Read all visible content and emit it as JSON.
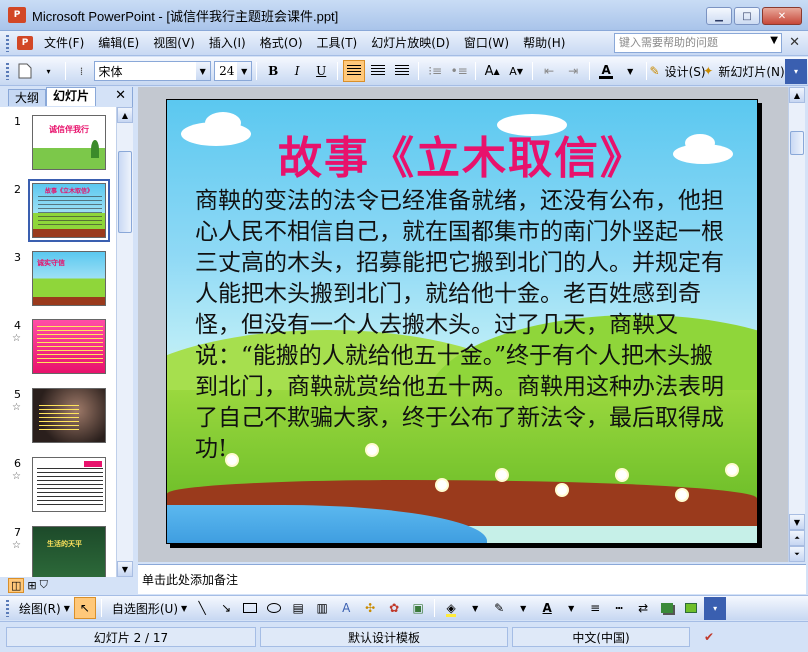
{
  "window": {
    "title": "Microsoft PowerPoint - [诚信伴我行主题班会课件.ppt]",
    "app_icon_label": "P"
  },
  "window_buttons": {
    "minimize": "▁",
    "maximize": "□",
    "close": "✕"
  },
  "menu": {
    "items": [
      "文件(F)",
      "编辑(E)",
      "视图(V)",
      "插入(I)",
      "格式(O)",
      "工具(T)",
      "幻灯片放映(D)",
      "窗口(W)",
      "帮助(H)"
    ],
    "help_placeholder": "键入需要帮助的问题"
  },
  "toolbar": {
    "font_name": "宋体",
    "font_size": "24",
    "bold": "B",
    "italic": "I",
    "underline": "U",
    "design_label": "设计(S)",
    "new_slide_label": "新幻灯片(N)"
  },
  "left_pane": {
    "tabs": [
      "大纲",
      "幻灯片"
    ],
    "selected_tab": "幻灯片",
    "thumbnails": [
      {
        "num": "1",
        "caption": "诚信伴我行"
      },
      {
        "num": "2",
        "caption": "故事《立木取信》"
      },
      {
        "num": "3",
        "caption": "诚实守信"
      },
      {
        "num": "4",
        "caption": ""
      },
      {
        "num": "5",
        "caption": ""
      },
      {
        "num": "6",
        "caption": ""
      },
      {
        "num": "7",
        "caption": "生活的天平"
      }
    ],
    "selected_thumbnail": "2"
  },
  "slide": {
    "title": "故事《立木取信》",
    "body": "商鞅的变法的法令已经准备就绪，还没有公布，他担心人民不相信自己，就在国都集市的南门外竖起一根三丈高的木头，招募能把它搬到北门的人。并规定有人能把木头搬到北门，就给他十金。老百姓感到奇怪，但没有一个人去搬木头。过了几天，商鞅又说：“能搬的人就给他五十金。”终于有个人把木头搬到北门，商鞅就赏给他五十两。商鞅用这种办法表明了自己不欺骗大家，终于公布了新法令，最后取得成功!"
  },
  "notes": {
    "placeholder": "单击此处添加备注"
  },
  "drawing_toolbar": {
    "draw_label": "绘图(R)",
    "autoshape_label": "自选图形(U)"
  },
  "status": {
    "slide_position": "幻灯片 2 / 17",
    "template": "默认设计模板",
    "language": "中文(中国)"
  },
  "colors": {
    "title_pink": "#e8126c",
    "sky": "#5bc8f0",
    "grass": "#8fd63a",
    "soil": "#9a3a1c"
  }
}
